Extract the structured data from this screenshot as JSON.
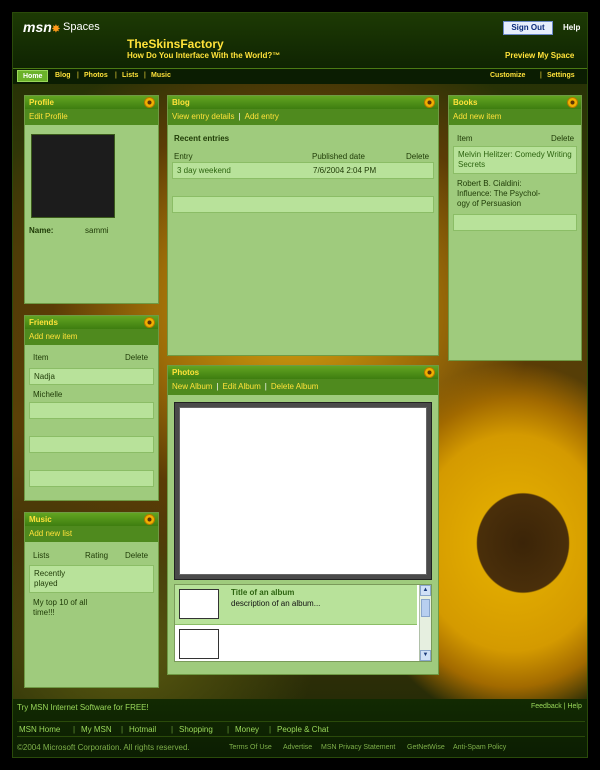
{
  "header": {
    "logo": "msn",
    "spaces": "Spaces",
    "sign_out": "Sign Out",
    "help": "Help",
    "title": "TheSkinsFactory",
    "tagline": "How Do You Interface With the World?™",
    "preview": "Preview My Space"
  },
  "nav": {
    "items": [
      "Home",
      "Blog",
      "Photos",
      "Lists",
      "Music"
    ],
    "right": [
      "Customize",
      "Settings"
    ]
  },
  "profile": {
    "title": "Profile",
    "edit": "Edit Profile",
    "name_label": "Name:",
    "name_value": "sammi"
  },
  "friends": {
    "title": "Friends",
    "add": "Add new item",
    "col_item": "Item",
    "col_delete": "Delete",
    "items": [
      "Nadja",
      "Michelle"
    ]
  },
  "music": {
    "title": "Music",
    "add": "Add new list",
    "col_lists": "Lists",
    "col_rating": "Rating",
    "col_delete": "Delete",
    "items": [
      "Recently played",
      "My top 10 of all time!!!"
    ]
  },
  "blog": {
    "title": "Blog",
    "view": "View entry details",
    "add": "Add entry",
    "recent": "Recent entries",
    "col_entry": "Entry",
    "col_date": "Published date",
    "col_delete": "Delete",
    "entries": [
      {
        "title": "3 day weekend",
        "date": "7/6/2004 2:04 PM"
      }
    ]
  },
  "books": {
    "title": "Books",
    "add": "Add new item",
    "col_item": "Item",
    "col_delete": "Delete",
    "items": [
      "Melvin Helitzer: Comedy Writing Secrets",
      "Robert B. Cialdini: Influence: The Psychol-ogy of Persuasion"
    ]
  },
  "photos": {
    "title": "Photos",
    "links": [
      "New Album",
      "Edit Album",
      "Delete Album"
    ],
    "album_title": "Title of an album",
    "album_desc": "description of an album..."
  },
  "footer": {
    "try": "Try MSN Internet Software for FREE!",
    "feedback": "Feedback | Help",
    "links": [
      "MSN Home",
      "My MSN",
      "Hotmail",
      "Shopping",
      "Money",
      "People & Chat"
    ],
    "copyright": "©2004 Microsoft Corporation. All rights reserved.",
    "legal": [
      "Terms Of Use",
      "Advertise",
      "MSN Privacy Statement",
      "GetNetWise",
      "Anti-Spam Policy"
    ]
  }
}
